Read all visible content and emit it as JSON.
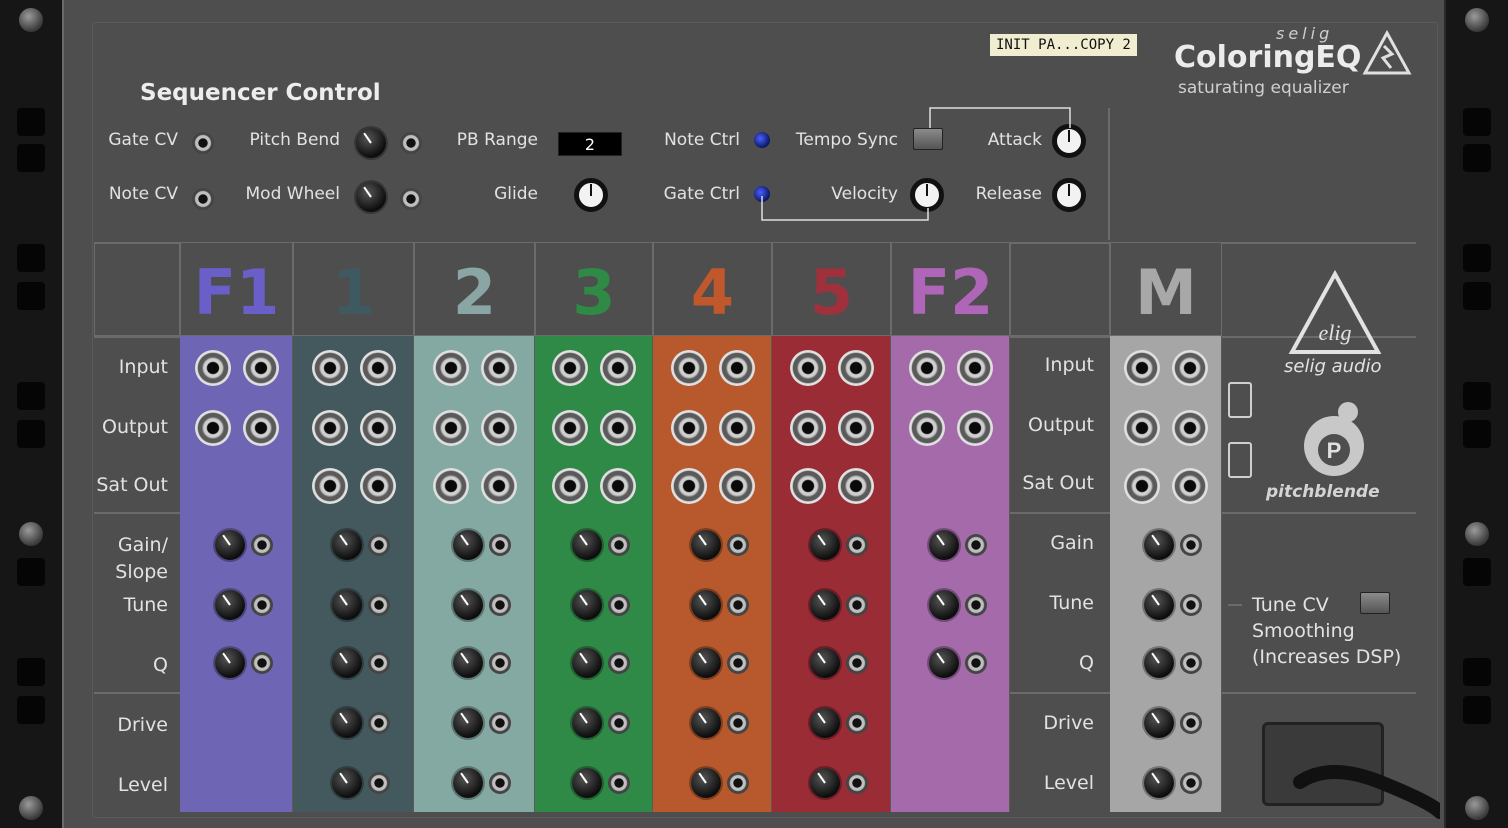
{
  "device": {
    "patch_name": "INIT PA...COPY 2",
    "brand_small": "selig",
    "product": "ColoringEQ",
    "tagline": "saturating equalizer",
    "logo_text": "selig audio",
    "partner": "pitchblende"
  },
  "sequencer": {
    "title": "Sequencer Control",
    "gate_cv": "Gate CV",
    "note_cv": "Note CV",
    "pitch_bend": "Pitch Bend",
    "mod_wheel": "Mod Wheel",
    "pb_range_label": "PB Range",
    "pb_range_value": "2",
    "glide": "Glide",
    "note_ctrl": "Note Ctrl",
    "gate_ctrl": "Gate Ctrl",
    "tempo_sync": "Tempo Sync",
    "velocity": "Velocity",
    "attack": "Attack",
    "release": "Release"
  },
  "rows": {
    "input": "Input",
    "output": "Output",
    "sat_out": "Sat Out",
    "gain_slope": "Gain/\nSlope",
    "gain": "Gain",
    "tune": "Tune",
    "q": "Q",
    "drive": "Drive",
    "level": "Level"
  },
  "bands": [
    {
      "id": "F1",
      "color": "#6e66b4",
      "text": "#6a5fc8"
    },
    {
      "id": "1",
      "color": "#44595d",
      "text": "#3e5960"
    },
    {
      "id": "2",
      "color": "#84a8a2",
      "text": "#8aa6a4"
    },
    {
      "id": "3",
      "color": "#2f8a47",
      "text": "#2e8a44"
    },
    {
      "id": "4",
      "color": "#b8592d",
      "text": "#c0582c"
    },
    {
      "id": "5",
      "color": "#9a2c36",
      "text": "#a0303c"
    },
    {
      "id": "F2",
      "color": "#a46aaa",
      "text": "#b066b8"
    },
    {
      "id": "M",
      "color": "#a6a6a6",
      "text": "#a8a8a8"
    }
  ],
  "tune_cv": {
    "line1": "Tune CV",
    "line2": "Smoothing",
    "line3": "(Increases DSP)"
  }
}
